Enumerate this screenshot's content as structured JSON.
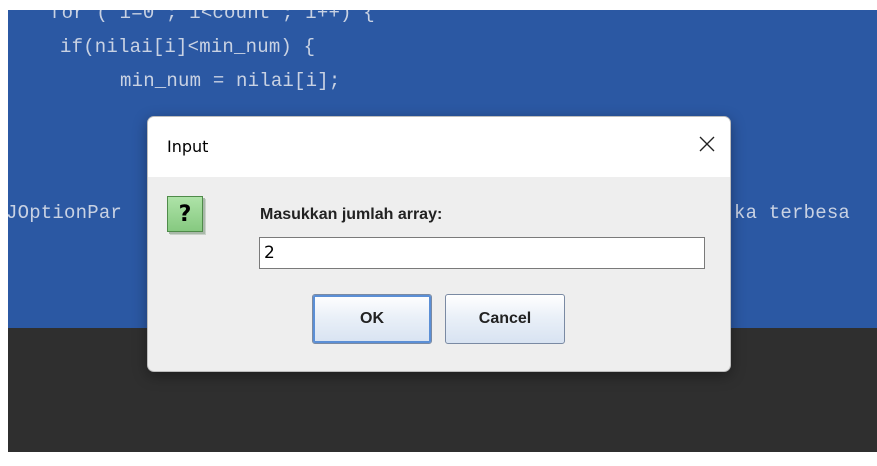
{
  "background": {
    "code_lines": [
      "for ( i=0 ; i<count ; i++) {",
      "if(nilai[i]<min_num) {",
      "min_num = nilai[i];",
      "JOptionPar",
      "ka terbesa"
    ],
    "colors": {
      "editor": "#2b58a3",
      "console": "#2f2f2f"
    }
  },
  "dialog": {
    "title": "Input",
    "close_icon": "close-icon",
    "icon": {
      "name": "question-icon",
      "glyph": "?"
    },
    "prompt": "Masukkan jumlah array:",
    "input_value": "2",
    "ok_label": "OK",
    "cancel_label": "Cancel",
    "colors": {
      "icon_fill": "#9bd694",
      "focus_ring": "#5b8fd6"
    }
  }
}
